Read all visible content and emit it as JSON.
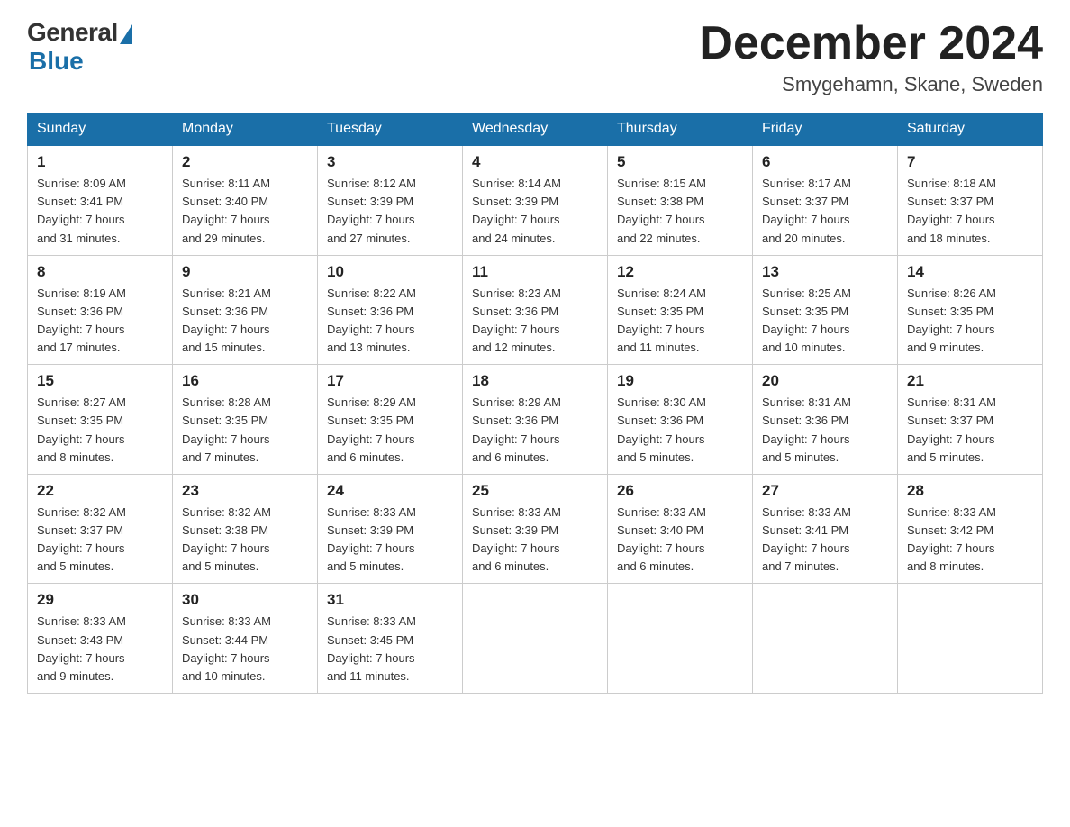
{
  "header": {
    "logo_general": "General",
    "logo_blue": "Blue",
    "month_title": "December 2024",
    "location": "Smygehamn, Skane, Sweden"
  },
  "days_of_week": [
    "Sunday",
    "Monday",
    "Tuesday",
    "Wednesday",
    "Thursday",
    "Friday",
    "Saturday"
  ],
  "weeks": [
    [
      {
        "num": "1",
        "info": "Sunrise: 8:09 AM\nSunset: 3:41 PM\nDaylight: 7 hours\nand 31 minutes."
      },
      {
        "num": "2",
        "info": "Sunrise: 8:11 AM\nSunset: 3:40 PM\nDaylight: 7 hours\nand 29 minutes."
      },
      {
        "num": "3",
        "info": "Sunrise: 8:12 AM\nSunset: 3:39 PM\nDaylight: 7 hours\nand 27 minutes."
      },
      {
        "num": "4",
        "info": "Sunrise: 8:14 AM\nSunset: 3:39 PM\nDaylight: 7 hours\nand 24 minutes."
      },
      {
        "num": "5",
        "info": "Sunrise: 8:15 AM\nSunset: 3:38 PM\nDaylight: 7 hours\nand 22 minutes."
      },
      {
        "num": "6",
        "info": "Sunrise: 8:17 AM\nSunset: 3:37 PM\nDaylight: 7 hours\nand 20 minutes."
      },
      {
        "num": "7",
        "info": "Sunrise: 8:18 AM\nSunset: 3:37 PM\nDaylight: 7 hours\nand 18 minutes."
      }
    ],
    [
      {
        "num": "8",
        "info": "Sunrise: 8:19 AM\nSunset: 3:36 PM\nDaylight: 7 hours\nand 17 minutes."
      },
      {
        "num": "9",
        "info": "Sunrise: 8:21 AM\nSunset: 3:36 PM\nDaylight: 7 hours\nand 15 minutes."
      },
      {
        "num": "10",
        "info": "Sunrise: 8:22 AM\nSunset: 3:36 PM\nDaylight: 7 hours\nand 13 minutes."
      },
      {
        "num": "11",
        "info": "Sunrise: 8:23 AM\nSunset: 3:36 PM\nDaylight: 7 hours\nand 12 minutes."
      },
      {
        "num": "12",
        "info": "Sunrise: 8:24 AM\nSunset: 3:35 PM\nDaylight: 7 hours\nand 11 minutes."
      },
      {
        "num": "13",
        "info": "Sunrise: 8:25 AM\nSunset: 3:35 PM\nDaylight: 7 hours\nand 10 minutes."
      },
      {
        "num": "14",
        "info": "Sunrise: 8:26 AM\nSunset: 3:35 PM\nDaylight: 7 hours\nand 9 minutes."
      }
    ],
    [
      {
        "num": "15",
        "info": "Sunrise: 8:27 AM\nSunset: 3:35 PM\nDaylight: 7 hours\nand 8 minutes."
      },
      {
        "num": "16",
        "info": "Sunrise: 8:28 AM\nSunset: 3:35 PM\nDaylight: 7 hours\nand 7 minutes."
      },
      {
        "num": "17",
        "info": "Sunrise: 8:29 AM\nSunset: 3:35 PM\nDaylight: 7 hours\nand 6 minutes."
      },
      {
        "num": "18",
        "info": "Sunrise: 8:29 AM\nSunset: 3:36 PM\nDaylight: 7 hours\nand 6 minutes."
      },
      {
        "num": "19",
        "info": "Sunrise: 8:30 AM\nSunset: 3:36 PM\nDaylight: 7 hours\nand 5 minutes."
      },
      {
        "num": "20",
        "info": "Sunrise: 8:31 AM\nSunset: 3:36 PM\nDaylight: 7 hours\nand 5 minutes."
      },
      {
        "num": "21",
        "info": "Sunrise: 8:31 AM\nSunset: 3:37 PM\nDaylight: 7 hours\nand 5 minutes."
      }
    ],
    [
      {
        "num": "22",
        "info": "Sunrise: 8:32 AM\nSunset: 3:37 PM\nDaylight: 7 hours\nand 5 minutes."
      },
      {
        "num": "23",
        "info": "Sunrise: 8:32 AM\nSunset: 3:38 PM\nDaylight: 7 hours\nand 5 minutes."
      },
      {
        "num": "24",
        "info": "Sunrise: 8:33 AM\nSunset: 3:39 PM\nDaylight: 7 hours\nand 5 minutes."
      },
      {
        "num": "25",
        "info": "Sunrise: 8:33 AM\nSunset: 3:39 PM\nDaylight: 7 hours\nand 6 minutes."
      },
      {
        "num": "26",
        "info": "Sunrise: 8:33 AM\nSunset: 3:40 PM\nDaylight: 7 hours\nand 6 minutes."
      },
      {
        "num": "27",
        "info": "Sunrise: 8:33 AM\nSunset: 3:41 PM\nDaylight: 7 hours\nand 7 minutes."
      },
      {
        "num": "28",
        "info": "Sunrise: 8:33 AM\nSunset: 3:42 PM\nDaylight: 7 hours\nand 8 minutes."
      }
    ],
    [
      {
        "num": "29",
        "info": "Sunrise: 8:33 AM\nSunset: 3:43 PM\nDaylight: 7 hours\nand 9 minutes."
      },
      {
        "num": "30",
        "info": "Sunrise: 8:33 AM\nSunset: 3:44 PM\nDaylight: 7 hours\nand 10 minutes."
      },
      {
        "num": "31",
        "info": "Sunrise: 8:33 AM\nSunset: 3:45 PM\nDaylight: 7 hours\nand 11 minutes."
      },
      {
        "num": "",
        "info": ""
      },
      {
        "num": "",
        "info": ""
      },
      {
        "num": "",
        "info": ""
      },
      {
        "num": "",
        "info": ""
      }
    ]
  ]
}
